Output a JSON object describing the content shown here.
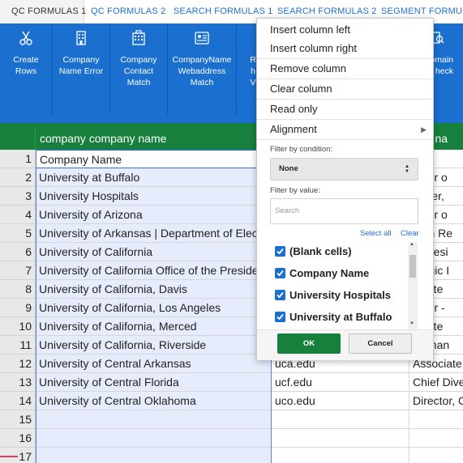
{
  "tabs": [
    "QC FORMULAS 1",
    "QC FORMULAS 2",
    "SEARCH FORMULAS 1",
    "SEARCH FORMULAS 2",
    "SEGMENT FORMULA"
  ],
  "toolbar": {
    "buttons": [
      {
        "label": "Create\nRows",
        "icon": "scissors-icon"
      },
      {
        "label": "Company\nName Error",
        "icon": "building-icon"
      },
      {
        "label": "Company\nContact\nMatch",
        "icon": "office-building-icon"
      },
      {
        "label": "CompanyName\nWebaddress\nMatch",
        "icon": "id-card-icon"
      },
      {
        "label": "R\nh\nV",
        "icon": "generic-icon"
      },
      {
        "label": "omain\nheck",
        "icon": "search-doc-icon"
      }
    ]
  },
  "grid": {
    "headers": [
      "company company name",
      "",
      "tact na"
    ],
    "rows": [
      {
        "num": "1",
        "c1": "Company Name",
        "c2": "",
        "c3": "e"
      },
      {
        "num": "2",
        "c1": "University at Buffalo",
        "c2": "",
        "c3": "ector o"
      },
      {
        "num": "3",
        "c1": "University Hospitals",
        "c2": "",
        "c3": "nager,"
      },
      {
        "num": "4",
        "c1": "University of Arizona",
        "c2": "",
        "c3": "ector o"
      },
      {
        "num": "5",
        "c1": "University of Arkansas | Department of Elec",
        "c2": "",
        "c3": "man Re"
      },
      {
        "num": "6",
        "c1": "University of California",
        "c2": "",
        "c3": "e Presi"
      },
      {
        "num": "7",
        "c1": "University of California Office of the Preside",
        "c2": "",
        "c3": "ategic I"
      },
      {
        "num": "8",
        "c1": "University of California, Davis",
        "c2": "",
        "c3": "ociate"
      },
      {
        "num": "9",
        "c1": "University of California, Los Angeles",
        "c2": "",
        "c3": "ector -"
      },
      {
        "num": "10",
        "c1": "University of California, Merced",
        "c2": "",
        "c3": "ociate"
      },
      {
        "num": "11",
        "c1": "University of California, Riverside",
        "c2": "",
        "c3": "e Chan"
      },
      {
        "num": "12",
        "c1": "University of Central Arkansas",
        "c2": "uca.edu",
        "c3": "Associate"
      },
      {
        "num": "13",
        "c1": "University of Central Florida",
        "c2": "ucf.edu",
        "c3": "Chief Dive"
      },
      {
        "num": "14",
        "c1": "University of Central Oklahoma",
        "c2": "uco.edu",
        "c3": "Director, C"
      },
      {
        "num": "15",
        "c1": "",
        "c2": "",
        "c3": ""
      },
      {
        "num": "16",
        "c1": "",
        "c2": "",
        "c3": ""
      },
      {
        "num": "17",
        "c1": "",
        "c2": "",
        "c3": ""
      }
    ]
  },
  "menu": {
    "insert_left": "Insert column left",
    "insert_right": "Insert column right",
    "remove": "Remove column",
    "clear": "Clear column",
    "read_only": "Read only",
    "alignment": "Alignment",
    "filter_condition_label": "Filter by condition:",
    "condition_value": "None",
    "filter_value_label": "Filter by value:",
    "search_placeholder": "Search",
    "select_all": "Select all",
    "clear_link": "Clear",
    "values": [
      "(Blank cells)",
      "Company Name",
      "University Hospitals",
      "University at Buffalo"
    ],
    "ok": "OK",
    "cancel": "Cancel"
  }
}
